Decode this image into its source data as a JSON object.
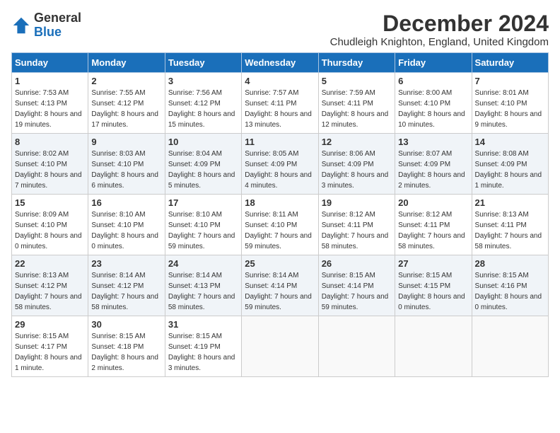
{
  "logo": {
    "general": "General",
    "blue": "Blue"
  },
  "title": "December 2024",
  "subtitle": "Chudleigh Knighton, England, United Kingdom",
  "days_of_week": [
    "Sunday",
    "Monday",
    "Tuesday",
    "Wednesday",
    "Thursday",
    "Friday",
    "Saturday"
  ],
  "weeks": [
    [
      {
        "day": "1",
        "sunrise": "7:53 AM",
        "sunset": "4:13 PM",
        "daylight": "8 hours and 19 minutes."
      },
      {
        "day": "2",
        "sunrise": "7:55 AM",
        "sunset": "4:12 PM",
        "daylight": "8 hours and 17 minutes."
      },
      {
        "day": "3",
        "sunrise": "7:56 AM",
        "sunset": "4:12 PM",
        "daylight": "8 hours and 15 minutes."
      },
      {
        "day": "4",
        "sunrise": "7:57 AM",
        "sunset": "4:11 PM",
        "daylight": "8 hours and 13 minutes."
      },
      {
        "day": "5",
        "sunrise": "7:59 AM",
        "sunset": "4:11 PM",
        "daylight": "8 hours and 12 minutes."
      },
      {
        "day": "6",
        "sunrise": "8:00 AM",
        "sunset": "4:10 PM",
        "daylight": "8 hours and 10 minutes."
      },
      {
        "day": "7",
        "sunrise": "8:01 AM",
        "sunset": "4:10 PM",
        "daylight": "8 hours and 9 minutes."
      }
    ],
    [
      {
        "day": "8",
        "sunrise": "8:02 AM",
        "sunset": "4:10 PM",
        "daylight": "8 hours and 7 minutes."
      },
      {
        "day": "9",
        "sunrise": "8:03 AM",
        "sunset": "4:10 PM",
        "daylight": "8 hours and 6 minutes."
      },
      {
        "day": "10",
        "sunrise": "8:04 AM",
        "sunset": "4:09 PM",
        "daylight": "8 hours and 5 minutes."
      },
      {
        "day": "11",
        "sunrise": "8:05 AM",
        "sunset": "4:09 PM",
        "daylight": "8 hours and 4 minutes."
      },
      {
        "day": "12",
        "sunrise": "8:06 AM",
        "sunset": "4:09 PM",
        "daylight": "8 hours and 3 minutes."
      },
      {
        "day": "13",
        "sunrise": "8:07 AM",
        "sunset": "4:09 PM",
        "daylight": "8 hours and 2 minutes."
      },
      {
        "day": "14",
        "sunrise": "8:08 AM",
        "sunset": "4:09 PM",
        "daylight": "8 hours and 1 minute."
      }
    ],
    [
      {
        "day": "15",
        "sunrise": "8:09 AM",
        "sunset": "4:10 PM",
        "daylight": "8 hours and 0 minutes."
      },
      {
        "day": "16",
        "sunrise": "8:10 AM",
        "sunset": "4:10 PM",
        "daylight": "8 hours and 0 minutes."
      },
      {
        "day": "17",
        "sunrise": "8:10 AM",
        "sunset": "4:10 PM",
        "daylight": "7 hours and 59 minutes."
      },
      {
        "day": "18",
        "sunrise": "8:11 AM",
        "sunset": "4:10 PM",
        "daylight": "7 hours and 59 minutes."
      },
      {
        "day": "19",
        "sunrise": "8:12 AM",
        "sunset": "4:11 PM",
        "daylight": "7 hours and 58 minutes."
      },
      {
        "day": "20",
        "sunrise": "8:12 AM",
        "sunset": "4:11 PM",
        "daylight": "7 hours and 58 minutes."
      },
      {
        "day": "21",
        "sunrise": "8:13 AM",
        "sunset": "4:11 PM",
        "daylight": "7 hours and 58 minutes."
      }
    ],
    [
      {
        "day": "22",
        "sunrise": "8:13 AM",
        "sunset": "4:12 PM",
        "daylight": "7 hours and 58 minutes."
      },
      {
        "day": "23",
        "sunrise": "8:14 AM",
        "sunset": "4:12 PM",
        "daylight": "7 hours and 58 minutes."
      },
      {
        "day": "24",
        "sunrise": "8:14 AM",
        "sunset": "4:13 PM",
        "daylight": "7 hours and 58 minutes."
      },
      {
        "day": "25",
        "sunrise": "8:14 AM",
        "sunset": "4:14 PM",
        "daylight": "7 hours and 59 minutes."
      },
      {
        "day": "26",
        "sunrise": "8:15 AM",
        "sunset": "4:14 PM",
        "daylight": "7 hours and 59 minutes."
      },
      {
        "day": "27",
        "sunrise": "8:15 AM",
        "sunset": "4:15 PM",
        "daylight": "8 hours and 0 minutes."
      },
      {
        "day": "28",
        "sunrise": "8:15 AM",
        "sunset": "4:16 PM",
        "daylight": "8 hours and 0 minutes."
      }
    ],
    [
      {
        "day": "29",
        "sunrise": "8:15 AM",
        "sunset": "4:17 PM",
        "daylight": "8 hours and 1 minute."
      },
      {
        "day": "30",
        "sunrise": "8:15 AM",
        "sunset": "4:18 PM",
        "daylight": "8 hours and 2 minutes."
      },
      {
        "day": "31",
        "sunrise": "8:15 AM",
        "sunset": "4:19 PM",
        "daylight": "8 hours and 3 minutes."
      },
      null,
      null,
      null,
      null
    ]
  ]
}
